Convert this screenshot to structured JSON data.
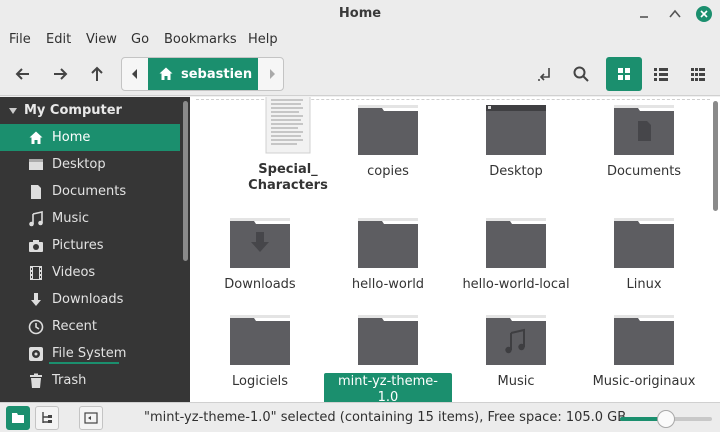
{
  "window": {
    "title": "Home"
  },
  "menu": [
    "File",
    "Edit",
    "View",
    "Go",
    "Bookmarks",
    "Help"
  ],
  "pathbar": {
    "current": "sebastien"
  },
  "sidebar": {
    "header": "My Computer",
    "items": [
      {
        "label": "Home",
        "icon": "home-icon",
        "active": true
      },
      {
        "label": "Desktop",
        "icon": "desktop-icon"
      },
      {
        "label": "Documents",
        "icon": "document-icon"
      },
      {
        "label": "Music",
        "icon": "music-icon"
      },
      {
        "label": "Pictures",
        "icon": "camera-icon"
      },
      {
        "label": "Videos",
        "icon": "film-icon"
      },
      {
        "label": "Downloads",
        "icon": "download-icon"
      },
      {
        "label": "Recent",
        "icon": "clock-icon"
      },
      {
        "label": "File System",
        "icon": "drive-icon"
      },
      {
        "label": "Trash",
        "icon": "trash-icon"
      }
    ]
  },
  "files": [
    {
      "name": "Special_\nCharacters",
      "type": "text-file"
    },
    {
      "name": "copies",
      "type": "folder"
    },
    {
      "name": "Desktop",
      "type": "folder-desktop"
    },
    {
      "name": "Documents",
      "type": "folder-documents"
    },
    {
      "name": "Downloads",
      "type": "folder-downloads"
    },
    {
      "name": "hello-world",
      "type": "folder"
    },
    {
      "name": "hello-world-local",
      "type": "folder"
    },
    {
      "name": "Linux",
      "type": "folder"
    },
    {
      "name": "Logiciels",
      "type": "folder"
    },
    {
      "name": "mint-yz-theme-1.0",
      "type": "folder",
      "selected": true
    },
    {
      "name": "Music",
      "type": "folder-music"
    },
    {
      "name": "Music-originaux",
      "type": "folder"
    }
  ],
  "status": {
    "text": "\"mint-yz-theme-1.0\" selected (containing 15 items), Free space: 105.0 GB",
    "zoom_level": 0.5
  },
  "colors": {
    "accent": "#1b8f6e",
    "sidebar_bg": "#363636",
    "folder": "#5d5d61"
  }
}
